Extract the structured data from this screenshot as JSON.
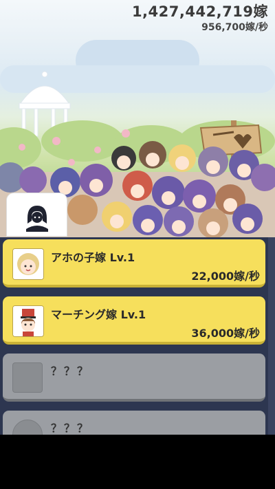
{
  "hud": {
    "total_brides": "1,427,442,719嫁",
    "rate_per_sec": "956,700嫁/秒"
  },
  "scene": {
    "character_icon": "avatar-silhouette-icon"
  },
  "list": {
    "items": [
      {
        "name": "アホの子嫁 Lv.1",
        "rate": "22,000嫁/秒",
        "state": "unlocked",
        "icon": "blonde-girl-portrait"
      },
      {
        "name": "マーチング嫁 Lv.1",
        "rate": "36,000嫁/秒",
        "state": "unlocked",
        "icon": "marching-girl-portrait"
      },
      {
        "name": "？？？",
        "rate": "",
        "state": "locked",
        "icon": "locked-square"
      },
      {
        "name": "？？？",
        "rate": "",
        "state": "locked",
        "icon": "locked-round"
      }
    ]
  },
  "colors": {
    "card_unlocked": "#f6df5c",
    "card_locked": "#9b9ea3",
    "panel_bg": "#2d3650"
  }
}
